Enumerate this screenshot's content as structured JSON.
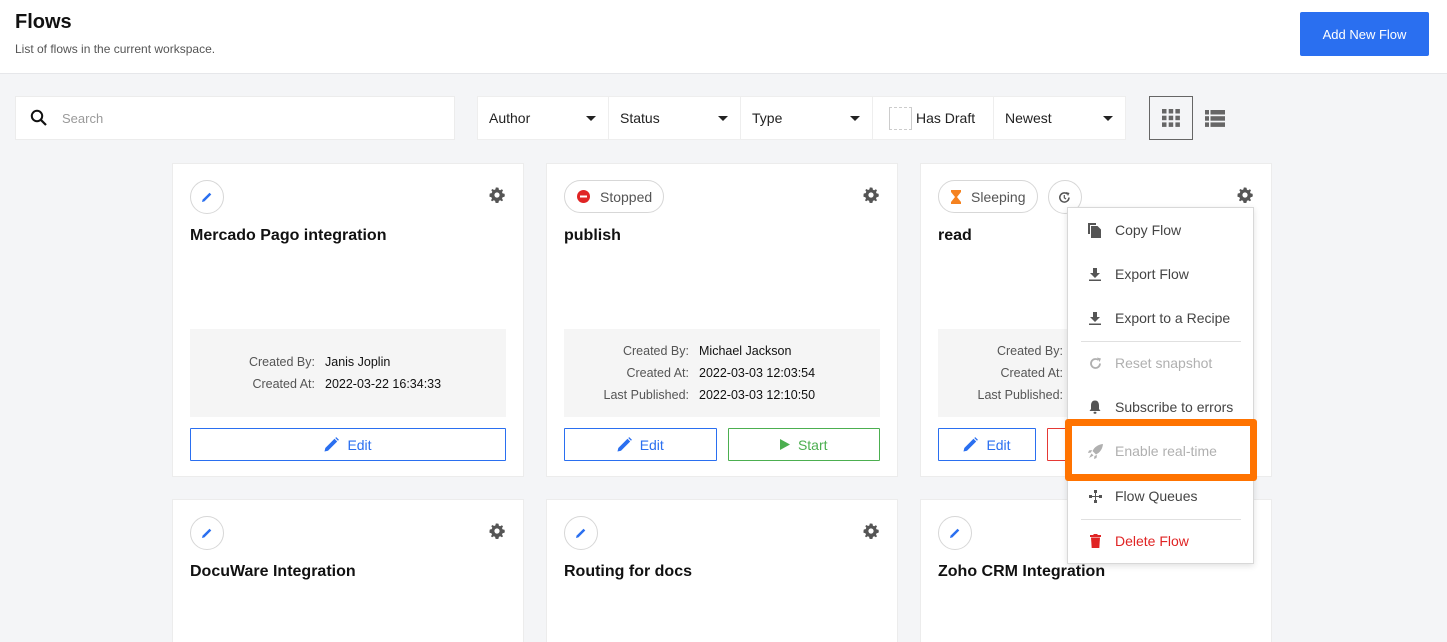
{
  "header": {
    "title": "Flows",
    "subtitle": "List of flows in the current workspace.",
    "add_button": "Add New Flow"
  },
  "toolbar": {
    "search_placeholder": "Search",
    "search_value": "",
    "filters": {
      "author": "Author",
      "status": "Status",
      "type": "Type",
      "has_draft": "Has Draft",
      "has_draft_checked": false,
      "sort": "Newest"
    },
    "view_mode": "grid"
  },
  "colors": {
    "primary": "#2a6ff0",
    "success": "#4caf50",
    "danger": "#e02424",
    "warning": "#f5821f",
    "highlight": "#ff7300"
  },
  "flows": [
    {
      "title": "Mercado Pago integration",
      "status": null,
      "meta": [
        {
          "label": "Created By:",
          "value": "Janis Joplin"
        },
        {
          "label": "Created At:",
          "value": "2022-03-22 16:34:33"
        }
      ],
      "buttons": {
        "edit": "Edit"
      }
    },
    {
      "title": "publish",
      "status": "Stopped",
      "meta": [
        {
          "label": "Created By:",
          "value": "Michael Jackson"
        },
        {
          "label": "Created At:",
          "value": "2022-03-03 12:03:54"
        },
        {
          "label": "Last Published:",
          "value": "2022-03-03 12:10:50"
        }
      ],
      "buttons": {
        "edit": "Edit",
        "start": "Start"
      }
    },
    {
      "title": "read",
      "status": "Sleeping",
      "meta": [
        {
          "label": "Created By:",
          "value": ""
        },
        {
          "label": "Created At:",
          "value": ""
        },
        {
          "label": "Last Published:",
          "value": ""
        }
      ],
      "buttons": {
        "edit": "Edit"
      }
    },
    {
      "title": "DocuWare Integration",
      "status": null
    },
    {
      "title": "Routing for docs",
      "status": null
    },
    {
      "title": "Zoho CRM Integration",
      "status": null
    }
  ],
  "context_menu": {
    "items": [
      {
        "label": "Copy Flow",
        "icon": "copy-icon",
        "state": "enabled"
      },
      {
        "label": "Export Flow",
        "icon": "download-icon",
        "state": "enabled"
      },
      {
        "label": "Export to a Recipe",
        "icon": "download-icon",
        "state": "enabled"
      },
      {
        "label": "Reset snapshot",
        "icon": "refresh-icon",
        "state": "disabled"
      },
      {
        "label": "Subscribe to errors",
        "icon": "bell-icon",
        "state": "enabled"
      },
      {
        "label": "Enable real-time",
        "icon": "rocket-icon",
        "state": "disabled",
        "highlighted": true
      },
      {
        "label": "Flow Queues",
        "icon": "queues-icon",
        "state": "enabled"
      },
      {
        "label": "Delete Flow",
        "icon": "trash-icon",
        "state": "danger"
      }
    ]
  }
}
